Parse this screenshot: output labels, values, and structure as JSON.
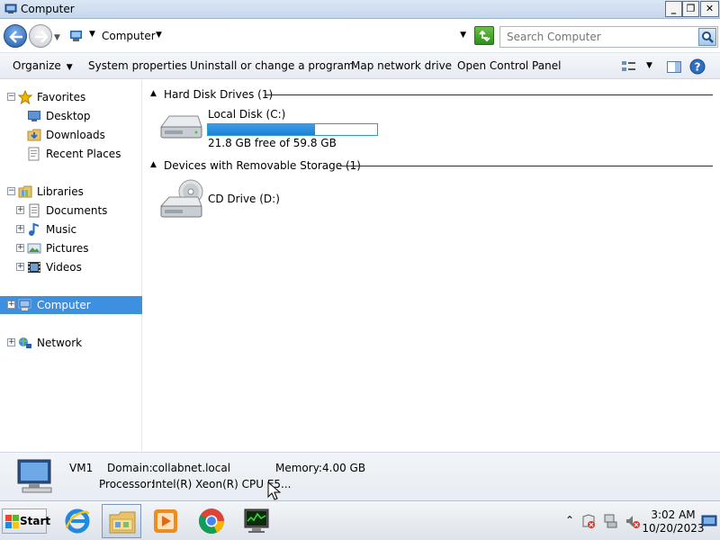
{
  "window": {
    "title": "Computer",
    "min_label": "_",
    "max_label": "❐",
    "close_label": "✕"
  },
  "address": {
    "crumb": "Computer",
    "search_placeholder": "Search Computer"
  },
  "toolbar": {
    "organize": "Organize",
    "system_properties": "System properties",
    "uninstall": "Uninstall or change a program",
    "map_drive": "Map network drive",
    "control_panel": "Open Control Panel"
  },
  "nav": {
    "favorites": "Favorites",
    "desktop": "Desktop",
    "downloads": "Downloads",
    "recent_places": "Recent Places",
    "libraries": "Libraries",
    "documents": "Documents",
    "music": "Music",
    "pictures": "Pictures",
    "videos": "Videos",
    "computer": "Computer",
    "network": "Network"
  },
  "content": {
    "hdd_group": "Hard Disk Drives (1)",
    "removable_group": "Devices with Removable Storage (1)",
    "drives": [
      {
        "name": "Local Disk (C:)",
        "free": "21.8 GB free of 59.8 GB",
        "used_fraction": 0.635
      },
      {
        "name": "CD Drive (D:)"
      }
    ]
  },
  "details": {
    "name": "VM1",
    "domain_label": "Domain:",
    "domain_value": "collabnet.local",
    "memory_label": "Memory:",
    "memory_value": "4.00 GB",
    "processor_label": "Processor:",
    "processor_value": "Intel(R) Xeon(R) CPU E5..."
  },
  "taskbar": {
    "start_label": "Start",
    "time": "3:02 AM",
    "date": "10/20/2023",
    "tray_expand": "⌃"
  },
  "colors": {
    "selection": "#3d8fe0",
    "progress": "#1f7fd6",
    "accent": "#1f5ba8"
  }
}
